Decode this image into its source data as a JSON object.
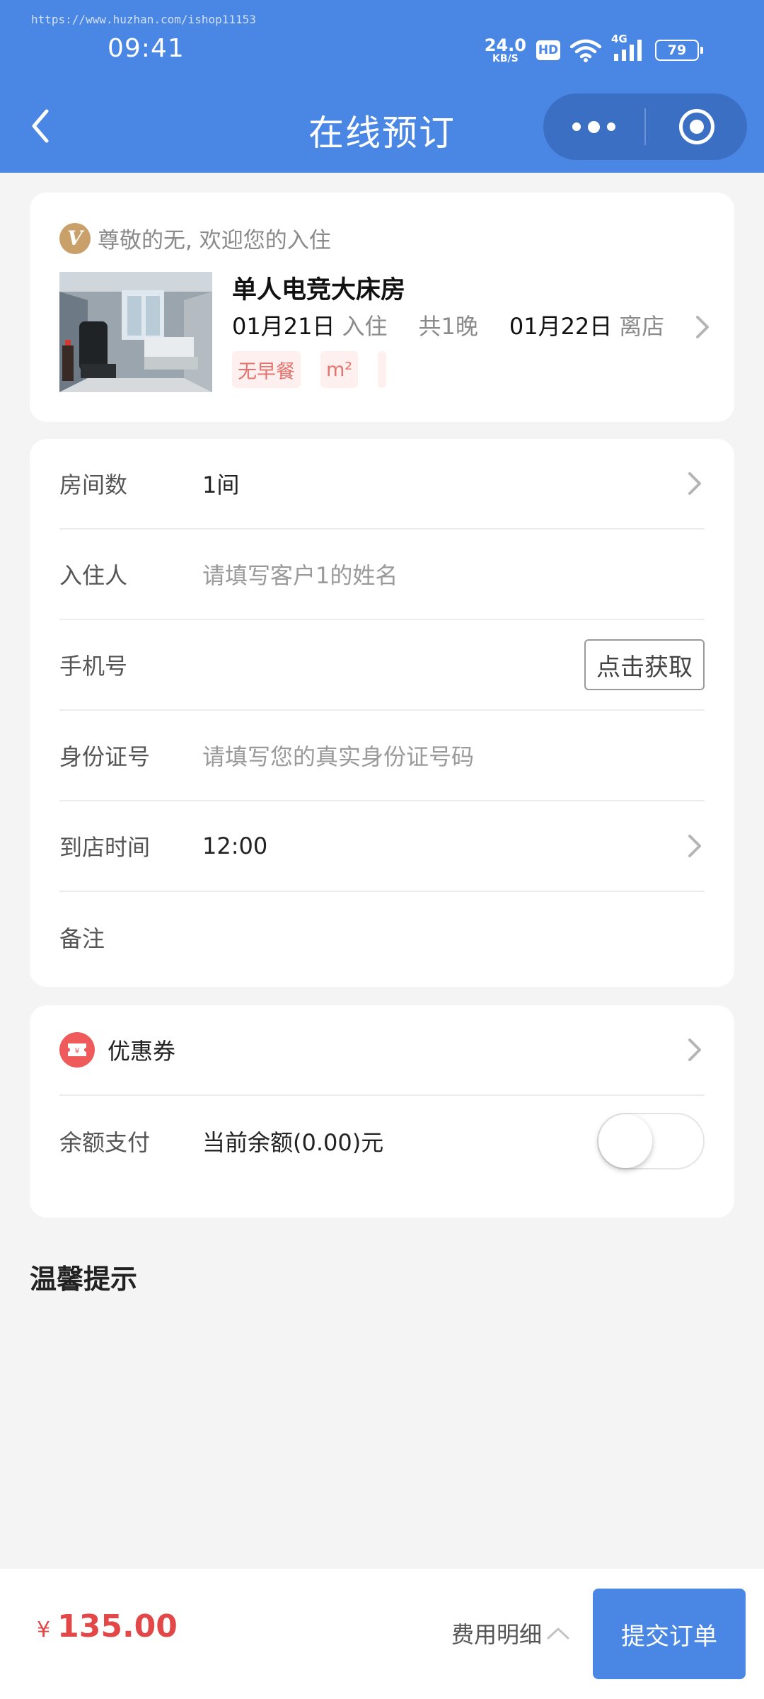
{
  "status_bar": {
    "watermark": "https://www.huzhan.com/ishop11153",
    "time": "09:41",
    "net_speed": "24.0",
    "net_unit": "KB/S",
    "hd": "HD",
    "network": "4G",
    "battery": "79"
  },
  "nav": {
    "title": "在线预订",
    "back_icon": "chevron-left-icon",
    "more_icon": "more-dots-icon",
    "close_icon": "target-circle-icon"
  },
  "hotel_card": {
    "welcome": "尊敬的无, 欢迎您的入住",
    "room_name": "单人电竞大床房",
    "checkin_date": "01月21日",
    "checkin_label": "入住",
    "nights": "共1晚",
    "checkout_date": "01月22日",
    "checkout_label": "离店",
    "tags": [
      "无早餐",
      "m²",
      ""
    ]
  },
  "form": {
    "rooms": {
      "label": "房间数",
      "value": "1间"
    },
    "guest": {
      "label": "入住人",
      "placeholder": "请填写客户1的姓名"
    },
    "phone": {
      "label": "手机号",
      "button": "点击获取"
    },
    "id_card": {
      "label": "身份证号",
      "placeholder": "请填写您的真实身份证号码"
    },
    "arrival": {
      "label": "到店时间",
      "value": "12:00"
    },
    "remark": {
      "label": "备注"
    }
  },
  "payment": {
    "coupon_label": "优惠券",
    "coupon_icon": "coupon-icon",
    "balance_label": "余额支付",
    "balance_value": "当前余额(0.00)元",
    "balance_toggle_on": false
  },
  "tips": {
    "title": "温馨提示"
  },
  "footer": {
    "currency": "¥",
    "price": "135.00",
    "detail_label": "费用明细",
    "submit_label": "提交订单"
  },
  "colors": {
    "primary": "#4a86e4",
    "price": "#e34848",
    "tag_text": "#e3736c",
    "tag_bg": "#fdf0ef",
    "vip_gold": "#c9a06a"
  }
}
